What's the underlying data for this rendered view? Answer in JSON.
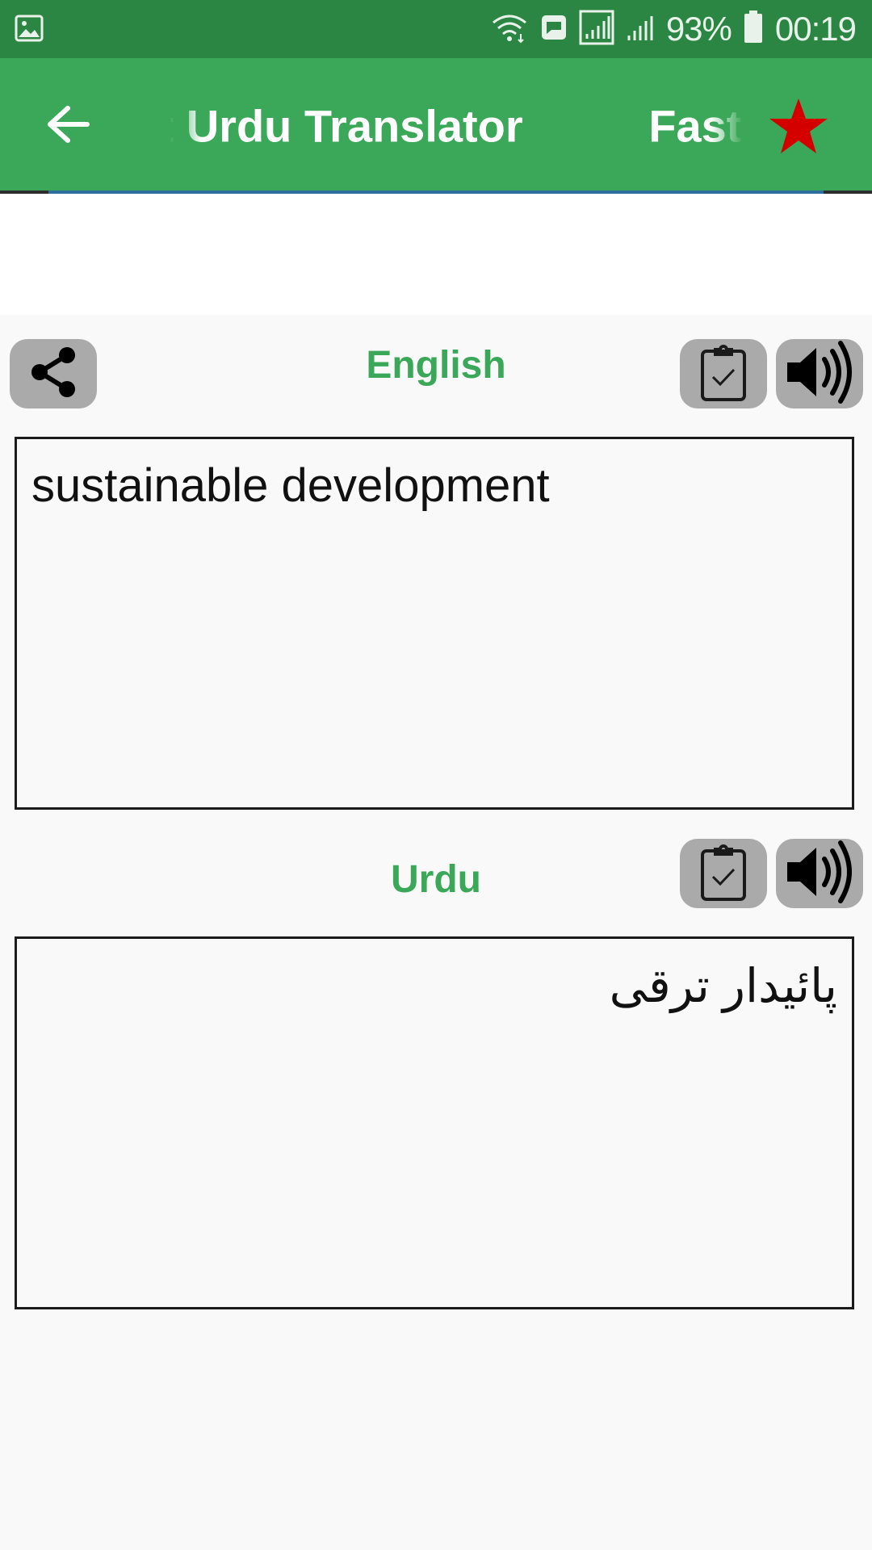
{
  "status_bar": {
    "battery_percent": "93%",
    "time": "00:19",
    "icons": [
      "gallery-icon",
      "wifi-icon",
      "message-icon",
      "signal-icon",
      "signal-icon",
      "battery-icon"
    ]
  },
  "app_bar": {
    "marquee_text": "Fast Urdu Translator          Fast Urdu Translator",
    "icons": [
      "back-arrow-icon",
      "star-icon"
    ],
    "colors": {
      "background": "#3aa858",
      "status": "#2b8643",
      "star": "#d40000"
    }
  },
  "source": {
    "language": "English",
    "text": "sustainable development",
    "icons": [
      "share-icon",
      "clipboard-check-icon",
      "speaker-icon"
    ]
  },
  "target": {
    "language": "Urdu",
    "text": "پائیدار ترقی",
    "icons": [
      "clipboard-check-icon",
      "speaker-icon"
    ]
  }
}
